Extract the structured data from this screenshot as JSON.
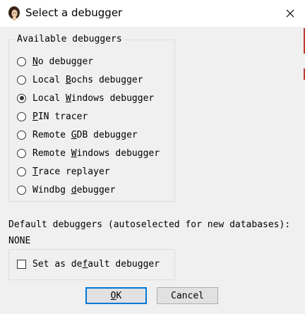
{
  "window": {
    "title": "Select a debugger",
    "close_glyph": "✕",
    "app_icon": "ida-portrait-icon"
  },
  "group": {
    "title": "Available debuggers",
    "options": [
      {
        "label": "No debugger",
        "accel_index": 0,
        "checked": false
      },
      {
        "label": "Local Bochs debugger",
        "accel_index": 6,
        "checked": false
      },
      {
        "label": "Local Windows debugger",
        "accel_index": 6,
        "checked": true
      },
      {
        "label": "PIN tracer",
        "accel_index": 0,
        "checked": false
      },
      {
        "label": "Remote GDB debugger",
        "accel_index": 7,
        "checked": false
      },
      {
        "label": "Remote Windows debugger",
        "accel_index": 7,
        "checked": false
      },
      {
        "label": "Trace replayer",
        "accel_index": 0,
        "checked": false
      },
      {
        "label": "Windbg debugger",
        "accel_index": 7,
        "checked": false
      }
    ]
  },
  "defaults": {
    "label": "Default debuggers (autoselected for new databases):",
    "value": "NONE"
  },
  "checkbox": {
    "label": "Set as default debugger",
    "accel_index": 9,
    "checked": false
  },
  "buttons": {
    "ok_label": "OK",
    "ok_accel_index": 0,
    "cancel_label": "Cancel"
  }
}
